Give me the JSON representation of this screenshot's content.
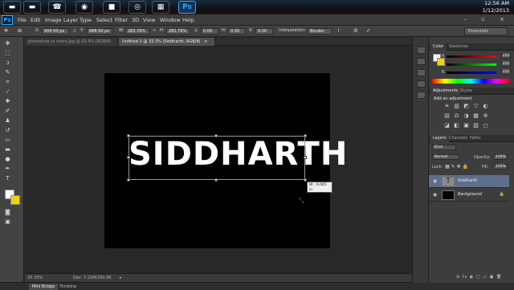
{
  "taskbar": {
    "apps": [
      {
        "name": "folder-app-icon",
        "glyph": "▬",
        "color": "#e0a83a"
      },
      {
        "name": "folder-app-icon-2",
        "glyph": "▬",
        "color": "#d8962e"
      },
      {
        "name": "talk-app-icon",
        "glyph": "☎",
        "color": "#2a9a3a"
      },
      {
        "name": "chrome-app-icon",
        "glyph": "◉",
        "color": "#2e7bd6"
      },
      {
        "name": "green-app-icon",
        "glyph": "■",
        "color": "#4caf50"
      },
      {
        "name": "red-app-icon",
        "glyph": "◎",
        "color": "#c0392b"
      },
      {
        "name": "doc-app-icon",
        "glyph": "▦",
        "color": "#9aa8b8"
      },
      {
        "name": "photoshop-app-icon",
        "glyph": "Ps",
        "color": "#1b3a5a"
      }
    ],
    "time": "12:56 AM",
    "date": "1/12/2013"
  },
  "menu": {
    "logo": "Ps",
    "items": [
      "File",
      "Edit",
      "Image",
      "Layer",
      "Type",
      "Select",
      "Filter",
      "3D",
      "View",
      "Window",
      "Help"
    ],
    "window_controls": "– ▫ ×"
  },
  "options": {
    "x_label": "X:",
    "x_value": "904.50 px",
    "y_label": "Y:",
    "y_value": "686.50 px",
    "w_label": "W:",
    "w_value": "282.76%",
    "h_label": "H:",
    "h_value": "282.76%",
    "angle_value": "0.00",
    "hskew_label": "H:",
    "hskew_value": "0.00",
    "vskew_label": "V:",
    "vskew_value": "0.00",
    "interp_label": "Interpolation:",
    "interp_value": "Bicubic",
    "workspace": "Essentials"
  },
  "tabs": [
    {
      "label": "photoshop cs overs.jpg @ 33.3% (RGB/8)",
      "close": "×"
    },
    {
      "label": "Untitled-1 @ 33.3% (Siddharth, RGB/8)",
      "close": "×"
    }
  ],
  "canvas": {
    "text": "SIDDHARTH",
    "info_w": "W :  6.065 in",
    "info_h": "H :  1.725 in"
  },
  "status": {
    "zoom": "33.33%",
    "doc": "Doc: 7.21M/293.9K",
    "arrow": "▸"
  },
  "bottom_tabs": [
    "Mini Bridge",
    "Timeline"
  ],
  "color_panel": {
    "tabs": [
      "Color",
      "Swatches"
    ],
    "sliders": [
      {
        "label": "R",
        "value": "255",
        "gradient": "linear-gradient(90deg,#000,#f00)"
      },
      {
        "label": "G",
        "value": "255",
        "gradient": "linear-gradient(90deg,#000,#0f0)"
      },
      {
        "label": "B",
        "value": "255",
        "gradient": "linear-gradient(90deg,#000,#00f)"
      }
    ]
  },
  "adjustments": {
    "tabs": [
      "Adjustments",
      "Styles"
    ],
    "title": "Add an adjustment",
    "row1": [
      "☀",
      "▥",
      "◩",
      "▽",
      "◐"
    ],
    "row2": [
      "▤",
      "⚖",
      "◑",
      "▦",
      "⊕"
    ],
    "row3": [
      "◪",
      "◧",
      "▣",
      "▨",
      "◻"
    ]
  },
  "layers_panel": {
    "tabs": [
      "Layers",
      "Channels",
      "Paths"
    ],
    "kind": "Kind",
    "blend": "Normal",
    "opacity_label": "Opacity:",
    "opacity": "100%",
    "lock_label": "Lock:",
    "fill_label": "Fill:",
    "fill": "100%",
    "layers": [
      {
        "name": "Siddharth",
        "thumb": "T"
      },
      {
        "name": "Background",
        "thumb": ""
      }
    ],
    "footer": "⊖ fx ◐ ▢ ▭ ▣ 🗑"
  }
}
